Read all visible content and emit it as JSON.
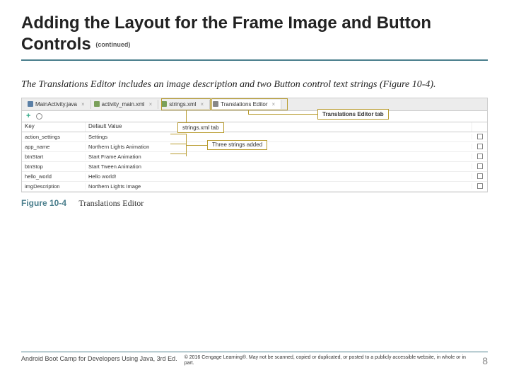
{
  "title": "Adding the Layout for the Frame Image and Button Controls",
  "continued": "(continued)",
  "intro": "The Translations Editor includes an image description and two Button control text strings (Figure 10-4).",
  "editor": {
    "tabs": [
      {
        "label": "MainActivity.java",
        "kind": "java"
      },
      {
        "label": "activity_main.xml",
        "kind": "xml"
      },
      {
        "label": "strings.xml",
        "kind": "xml"
      },
      {
        "label": "Translations Editor",
        "kind": "trans"
      }
    ],
    "header": {
      "key": "Key",
      "default": "Default Value"
    },
    "rows": [
      {
        "key": "action_settings",
        "value": "Settings"
      },
      {
        "key": "app_name",
        "value": "Northern Lights Animation"
      },
      {
        "key": "btnStart",
        "value": "Start Frame Animation"
      },
      {
        "key": "btnStop",
        "value": "Start Tween Animation"
      },
      {
        "key": "hello_world",
        "value": "Hello world!"
      },
      {
        "key": "imgDescription",
        "value": "Northern Lights Image"
      }
    ]
  },
  "callouts": {
    "strings_tab": "strings.xml tab",
    "translations_tab": "Translations Editor tab",
    "three_strings": "Three strings added"
  },
  "figure": {
    "number": "Figure 10-4",
    "caption": "Translations Editor"
  },
  "footer": {
    "source": "Android Boot Camp for Developers Using Java, 3rd Ed.",
    "copyright": "© 2016 Cengage Learning®. May not be scanned, copied or duplicated, or posted to a publicly accessible website, in whole or in part.",
    "page": "8"
  }
}
